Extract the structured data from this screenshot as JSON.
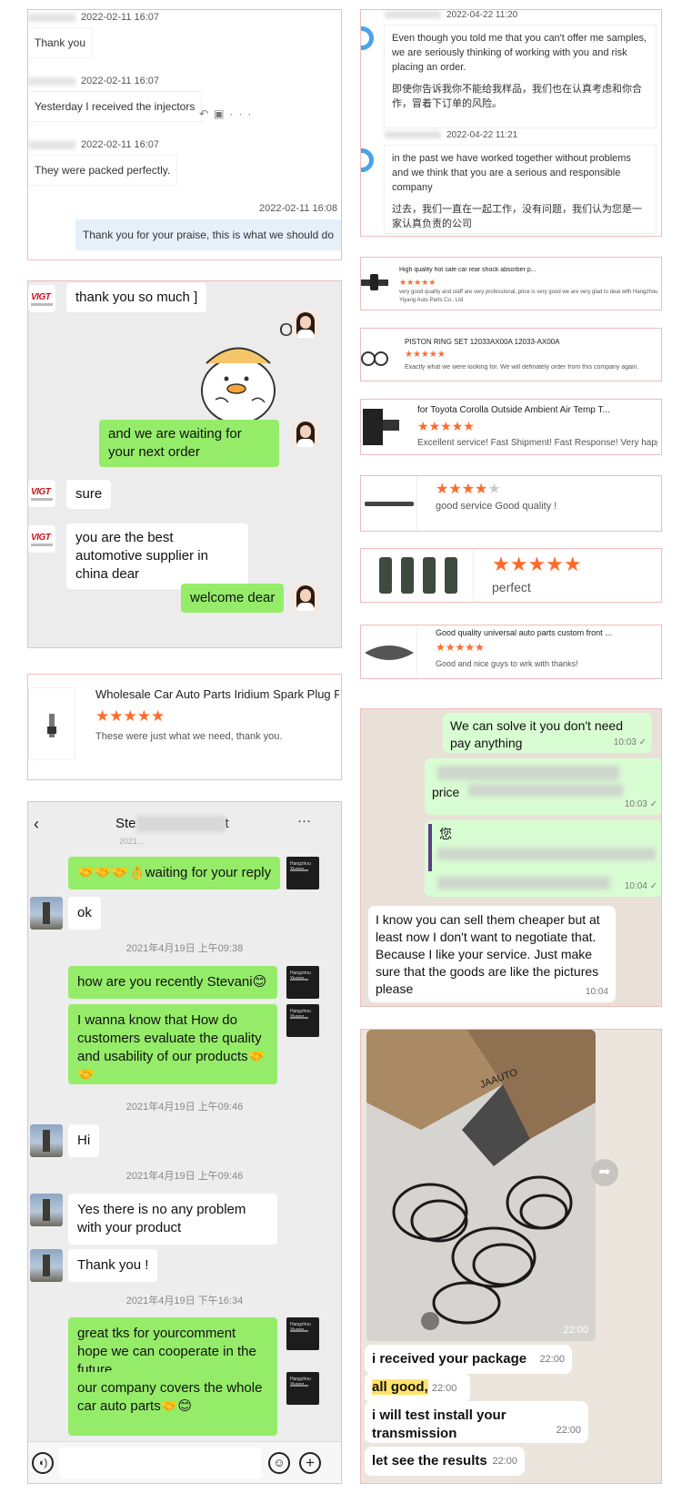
{
  "panel_a": {
    "messages": [
      {
        "time": "2022-02-11 16:07",
        "text": "Thank you"
      },
      {
        "time": "2022-02-11 16:07",
        "text": "Yesterday I received the injectors"
      },
      {
        "time": "2022-02-11 16:07",
        "text": "They were packed perfectly."
      },
      {
        "time": "2022-02-11 16:08",
        "text": "Thank you for your praise, this is what we should do"
      }
    ]
  },
  "panel_b": {
    "messages": [
      {
        "time": "2022-04-22 11:20",
        "en": "Even though you told me that you can't offer me samples, we are seriously thinking of working with you and risk placing an order.",
        "zh": "即使你告诉我你不能给我样品，我们也在认真考虑和你合作，冒着下订单的风险。"
      },
      {
        "time": "2022-04-22 11:21",
        "en": "in the past we have worked together without problems and we think that you are a serious and responsible company",
        "zh": "过去，我们一直在一起工作，没有问题，我们认为您是一家认真负责的公司"
      }
    ]
  },
  "reviews": [
    {
      "title": "High quality hot sale car rear shock absorber p...",
      "stars": 5,
      "comment": "very good quality and staff are very professional, price is very good we are very glad to deal with Hangzhou Yiyang Auto Parts Co., Ltd"
    },
    {
      "title": "PISTON RING SET 12033AX00A 12033-AX00A",
      "stars": 5,
      "comment": "Exactly what we were looking for. We will definately order from this company again."
    },
    {
      "title": "for Toyota Corolla Outside Ambient Air Temp T...",
      "stars": 5,
      "comment": "Excellent service! Fast Shipment! Fast Response! Very happy"
    },
    {
      "title": "",
      "stars": 4,
      "comment": "good service Good quality !"
    },
    {
      "title": "",
      "stars": 5,
      "comment": "perfect"
    },
    {
      "title": "Good quality universal auto parts custom front ...",
      "stars": 5,
      "comment": "Good and nice guys to wrk with thanks!"
    }
  ],
  "panel_c": {
    "logo_text": "VIGT",
    "sticker_text": "OK",
    "messages": [
      {
        "from": "customer",
        "text": "thank you so much ]"
      },
      {
        "from": "me",
        "text": "and we are waiting for your next order"
      },
      {
        "from": "customer",
        "text": "sure"
      },
      {
        "from": "customer",
        "text": "you are the best automotive supplier in china dear"
      },
      {
        "from": "me",
        "text": "welcome dear"
      }
    ]
  },
  "panel_d": {
    "title": "Wholesale Car Auto Parts Iridium Spark Plug F...",
    "stars": 5,
    "comment": "These were just what we need, thank you."
  },
  "panel_e": {
    "header_name": "Ste",
    "header_suffix": "t",
    "back_icon": "chevron-left-icon",
    "more_label": "···",
    "partial_top_time": "2021...",
    "messages": [
      {
        "kind": "me",
        "text": "🤝🤝🤝👌waiting for your reply"
      },
      {
        "kind": "them",
        "text": "ok"
      },
      {
        "kind": "time",
        "text": "2021年4月19日 上午09:38"
      },
      {
        "kind": "me",
        "text": "how are you recently Stevani😊"
      },
      {
        "kind": "me",
        "text": "I wanna know that How do customers evaluate the quality and usability of our products🤝🤝"
      },
      {
        "kind": "time",
        "text": "2021年4月19日 上午09:46"
      },
      {
        "kind": "them",
        "text": "Hi"
      },
      {
        "kind": "time",
        "text": "2021年4月19日 上午09:46"
      },
      {
        "kind": "them",
        "text": "Yes there is no any problem with your product"
      },
      {
        "kind": "them",
        "text": "Thank you !"
      },
      {
        "kind": "time",
        "text": "2021年4月19日 下午16:34"
      },
      {
        "kind": "me",
        "text": "great tks for yourcomment hope we can cooperate in the future"
      },
      {
        "kind": "me",
        "text": "our company covers the whole car auto parts🤝😊"
      }
    ]
  },
  "panel_f": {
    "messages": [
      {
        "text": "We can solve it you don't need pay anything",
        "time": "10:03 ✓"
      },
      {
        "text": "price",
        "time": "10:03 ✓"
      },
      {
        "text": "您",
        "time": "10:04 ✓"
      },
      {
        "text": "I know you can sell them cheaper but at least now I don't want to negotiate that. Because I like your service. Just make sure that the goods are like the pictures please",
        "time": "10:04"
      }
    ]
  },
  "panel_g": {
    "photo_time": "22:00",
    "box_label": "JAAUTO",
    "share_icon": "forward-icon",
    "messages": [
      {
        "text": "i received your package",
        "time": "22:00"
      },
      {
        "text": "all good,",
        "time": "22:00"
      },
      {
        "text": "i will test install your transmission",
        "time": "22:00"
      },
      {
        "text": "let see the results",
        "time": "22:00"
      }
    ]
  },
  "colors": {
    "wechat_green": "#95ec69",
    "whatsapp_green": "#d9fdd3",
    "star_orange": "#ff6a2a",
    "panel_border": "#f0bcbc"
  }
}
